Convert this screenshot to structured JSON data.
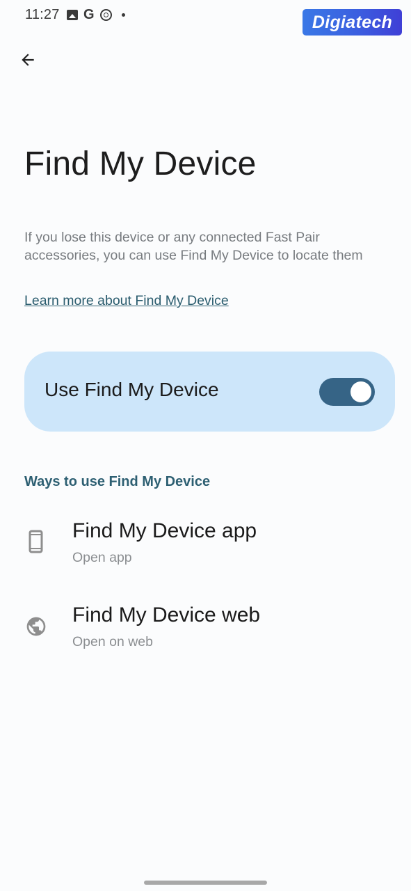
{
  "status_bar": {
    "time": "11:27",
    "icons": [
      "image-icon",
      "google-icon",
      "sync-icon",
      "dot-icon"
    ],
    "google_glyph": "G"
  },
  "watermark": {
    "text": "Digiatech"
  },
  "header": {
    "back_icon": "arrow-back-icon",
    "title": "Find My Device"
  },
  "description": "If you lose this device or any connected Fast Pair accessories, you can use Find My Device to locate them",
  "learn_more_link": "Learn more about Find My Device",
  "main_toggle": {
    "label": "Use Find My Device",
    "enabled": true
  },
  "section": {
    "title": "Ways to use Find My Device",
    "items": [
      {
        "icon": "smartphone-icon",
        "title": "Find My Device app",
        "subtitle": "Open app"
      },
      {
        "icon": "globe-icon",
        "title": "Find My Device web",
        "subtitle": "Open on web"
      }
    ]
  },
  "colors": {
    "background": "#fbfcfd",
    "card": "#cde6fa",
    "switch_track": "#366486",
    "accent_text": "#2d5f72",
    "link": "#2a5c6e"
  }
}
